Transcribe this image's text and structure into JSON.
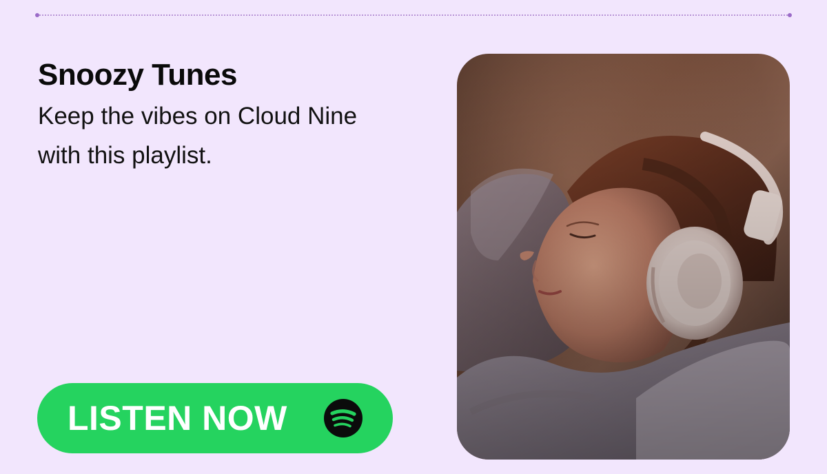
{
  "card": {
    "title": "Snoozy Tunes",
    "subtitle": "Keep the vibes on Cloud Nine with this playlist."
  },
  "cta": {
    "label": "LISTEN NOW",
    "icon": "spotify-logo-icon"
  },
  "colors": {
    "background": "#f2e6fd",
    "button": "#25d35f",
    "button_text": "#ffffff",
    "icon": "#0b0b0b",
    "accent_dot": "#9b6bc8"
  },
  "hero_image": {
    "subject": "sleeping-woman-with-headphones"
  }
}
